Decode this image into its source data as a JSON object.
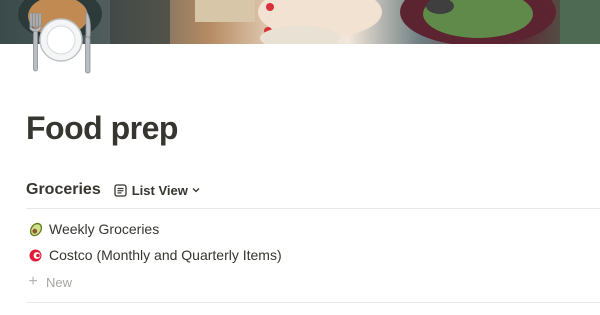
{
  "page": {
    "title": "Food prep",
    "icon": "fork-plate-knife-icon"
  },
  "database": {
    "title": "Groceries",
    "view": {
      "label": "List View",
      "icon": "list-view-icon",
      "chevron": "chevron-down-icon"
    },
    "items": [
      {
        "label": "Weekly Groceries",
        "icon": "avocado-icon"
      },
      {
        "label": "Costco (Monthly and Quarterly Items)",
        "icon": "costco-logo-icon"
      }
    ],
    "new_label": "New"
  },
  "colors": {
    "text": "#37352f",
    "muted": "#a6a6a2",
    "divider": "#e9e9e7",
    "costco_red": "#e31837",
    "avocado_green": "#7a9a2e"
  }
}
